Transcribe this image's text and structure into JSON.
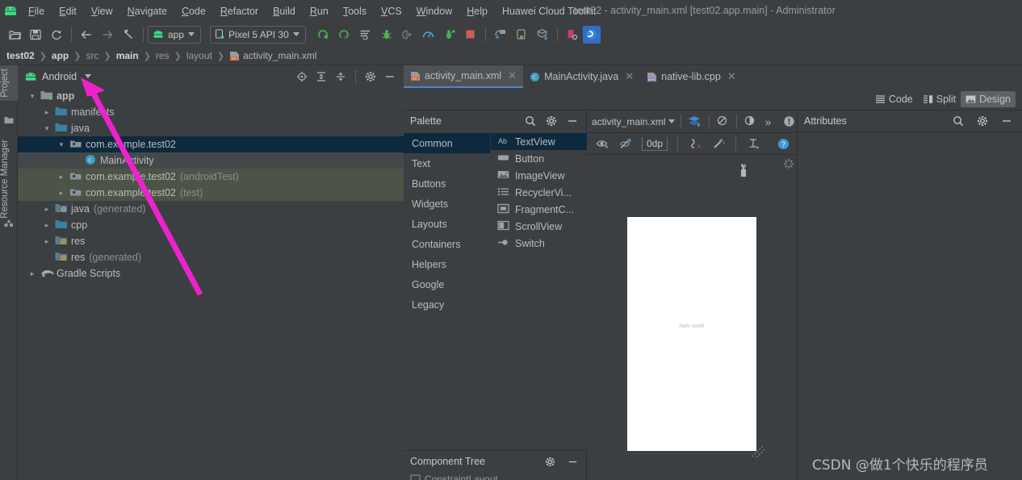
{
  "window": {
    "title": "test02 - activity_main.xml [test02.app.main] - Administrator",
    "app_logo": "android-logo-icon"
  },
  "menubar": {
    "items": [
      "File",
      "Edit",
      "View",
      "Navigate",
      "Code",
      "Refactor",
      "Build",
      "Run",
      "Tools",
      "VCS",
      "Window",
      "Help",
      "Huawei Cloud Toolkit"
    ]
  },
  "toolbar": {
    "buttons": [
      {
        "name": "open-folder-icon",
        "label": ""
      },
      {
        "name": "save-all-icon",
        "label": ""
      },
      {
        "name": "sync-icon",
        "label": ""
      },
      {
        "name": "back-icon",
        "label": ""
      },
      {
        "name": "forward-icon",
        "label": ""
      },
      {
        "name": "jump-to-source-icon",
        "label": ""
      }
    ],
    "module_selector": "app",
    "device_selector": "Pixel 5 API 30",
    "right_buttons": [
      {
        "name": "run-icon"
      },
      {
        "name": "run-with-coverage-icon"
      },
      {
        "name": "make-project-icon"
      },
      {
        "name": "debug-icon"
      },
      {
        "name": "attach-debugger-icon"
      },
      {
        "name": "profiler-icon"
      },
      {
        "name": "run-apply-changes-icon"
      },
      {
        "name": "stop-icon"
      },
      {
        "name": "avd-manager-icon"
      },
      {
        "name": "device-manager-icon"
      },
      {
        "name": "sdk-manager-icon"
      },
      {
        "name": "layout-inspector-icon"
      },
      {
        "name": "search-everywhere-icon"
      }
    ]
  },
  "breadcrumb": {
    "items": [
      {
        "label": "test02",
        "style": "bold"
      },
      {
        "label": "app",
        "style": "bold"
      },
      {
        "label": "src",
        "style": "dim"
      },
      {
        "label": "main",
        "style": "bold"
      },
      {
        "label": "res",
        "style": "dim"
      },
      {
        "label": "layout",
        "style": "dim"
      },
      {
        "label": "activity_main.xml",
        "style": "file"
      }
    ]
  },
  "left_stripe": {
    "tabs": [
      {
        "label": "Project",
        "selected": true,
        "icon": "project-icon"
      },
      {
        "label": "Resource Manager",
        "selected": false,
        "icon": "resource-manager-icon"
      }
    ]
  },
  "project_panel": {
    "title": "Android",
    "header_buttons": [
      "locate-icon",
      "expand-all-icon",
      "collapse-all-icon",
      "settings-gear-icon",
      "hide-icon"
    ],
    "tree": [
      {
        "indent": 0,
        "twisty": "down",
        "icon": "module-icon",
        "label": "app",
        "bold": true,
        "dim": "",
        "highlight": "none"
      },
      {
        "indent": 1,
        "twisty": "right",
        "icon": "folder-icon",
        "label": "manifests",
        "bold": false,
        "dim": "",
        "highlight": "none"
      },
      {
        "indent": 1,
        "twisty": "down",
        "icon": "folder-icon",
        "label": "java",
        "bold": false,
        "dim": "",
        "highlight": "none"
      },
      {
        "indent": 2,
        "twisty": "down",
        "icon": "package-icon",
        "label": "com.example.test02",
        "bold": false,
        "dim": "",
        "highlight": "blue"
      },
      {
        "indent": 3,
        "twisty": "none",
        "icon": "class-icon",
        "label": "MainActivity",
        "bold": false,
        "dim": "",
        "highlight": "gray"
      },
      {
        "indent": 2,
        "twisty": "right",
        "icon": "package-icon",
        "label": "com.example.test02",
        "bold": false,
        "dim": "(androidTest)",
        "highlight": "green"
      },
      {
        "indent": 2,
        "twisty": "right",
        "icon": "package-icon",
        "label": "com.example.test02",
        "bold": false,
        "dim": "(test)",
        "highlight": "green"
      },
      {
        "indent": 1,
        "twisty": "right",
        "icon": "folder-gen-icon",
        "label": "java",
        "bold": false,
        "dim": "(generated)",
        "highlight": "none"
      },
      {
        "indent": 1,
        "twisty": "right",
        "icon": "folder-icon",
        "label": "cpp",
        "bold": false,
        "dim": "",
        "highlight": "none"
      },
      {
        "indent": 1,
        "twisty": "right",
        "icon": "folder-res-icon",
        "label": "res",
        "bold": false,
        "dim": "",
        "highlight": "none"
      },
      {
        "indent": 1,
        "twisty": "none",
        "icon": "folder-res-icon",
        "label": "res",
        "bold": false,
        "dim": "(generated)",
        "highlight": "none"
      },
      {
        "indent": 0,
        "twisty": "right",
        "icon": "gradle-icon",
        "label": "Gradle Scripts",
        "bold": false,
        "dim": "",
        "highlight": "none"
      }
    ]
  },
  "editor": {
    "tabs": [
      {
        "label": "activity_main.xml",
        "icon": "xml-layout-icon",
        "active": true
      },
      {
        "label": "MainActivity.java",
        "icon": "java-class-icon",
        "active": false
      },
      {
        "label": "native-lib.cpp",
        "icon": "cpp-file-icon",
        "active": false
      }
    ],
    "close_glyph": "✕",
    "modes": [
      {
        "label": "Code",
        "icon": "code-mode-icon",
        "active": false
      },
      {
        "label": "Split",
        "icon": "split-mode-icon",
        "active": false
      },
      {
        "label": "Design",
        "icon": "design-mode-icon",
        "active": true
      }
    ]
  },
  "palette": {
    "title": "Palette",
    "header_buttons": [
      "search-icon",
      "settings-gear-icon",
      "hide-icon"
    ],
    "categories": [
      {
        "label": "Common",
        "selected": true
      },
      {
        "label": "Text",
        "selected": false
      },
      {
        "label": "Buttons",
        "selected": false
      },
      {
        "label": "Widgets",
        "selected": false
      },
      {
        "label": "Layouts",
        "selected": false
      },
      {
        "label": "Containers",
        "selected": false
      },
      {
        "label": "Helpers",
        "selected": false
      },
      {
        "label": "Google",
        "selected": false
      },
      {
        "label": "Legacy",
        "selected": false
      }
    ],
    "items": [
      {
        "label": "TextView",
        "icon": "textview-icon",
        "selected": true
      },
      {
        "label": "Button",
        "icon": "button-icon",
        "selected": false
      },
      {
        "label": "ImageView",
        "icon": "imageview-icon",
        "selected": false
      },
      {
        "label": "RecyclerVi...",
        "icon": "recyclerview-icon",
        "selected": false
      },
      {
        "label": "FragmentC...",
        "icon": "fragmentcontainer-icon",
        "selected": false
      },
      {
        "label": "ScrollView",
        "icon": "scrollview-icon",
        "selected": false
      },
      {
        "label": "Switch",
        "icon": "switch-icon",
        "selected": false
      }
    ]
  },
  "component_tree": {
    "title": "Component Tree",
    "header_buttons": [
      "settings-gear-icon",
      "hide-icon"
    ]
  },
  "design_surface": {
    "file_selector": "activity_main.xml",
    "toolbar_row1": [
      "design-surface-mode-icon",
      "blueprint-orientation-icon",
      "night-mode-icon",
      "overflow-chevrons-icon",
      "issues-icon"
    ],
    "toolbar_row2": [
      "show-constraints-icon",
      "autoconnect-off-icon",
      "clear-constraints-icon",
      "infer-constraints-icon",
      "default-margin-icon",
      "guidelines-icon",
      "help-icon"
    ],
    "default_margin": "0dp",
    "overflow_glyph": "»",
    "preview_text": "Hello world!",
    "wrench_icon": "wrench-icon",
    "resize_handle_icon": "resize-handle-icon",
    "loading_icon": "loading-spinner-icon"
  },
  "attributes": {
    "title": "Attributes",
    "header_buttons": [
      "search-icon",
      "settings-gear-icon",
      "hide-icon"
    ]
  },
  "watermark": {
    "text": "CSDN @做1个快乐的程序员"
  },
  "annotation": {
    "arrow_color": "#ee22cc",
    "name": "pink-annotation-arrow"
  },
  "colors": {
    "bg": "#3c3f41",
    "selection_blue": "#0d293e",
    "selection_gray": "#45484a",
    "selection_green": "#4b5447",
    "accent_blue": "#4a88c7",
    "folder_blue": "#3d7a96",
    "android_green": "#3ddc84"
  }
}
